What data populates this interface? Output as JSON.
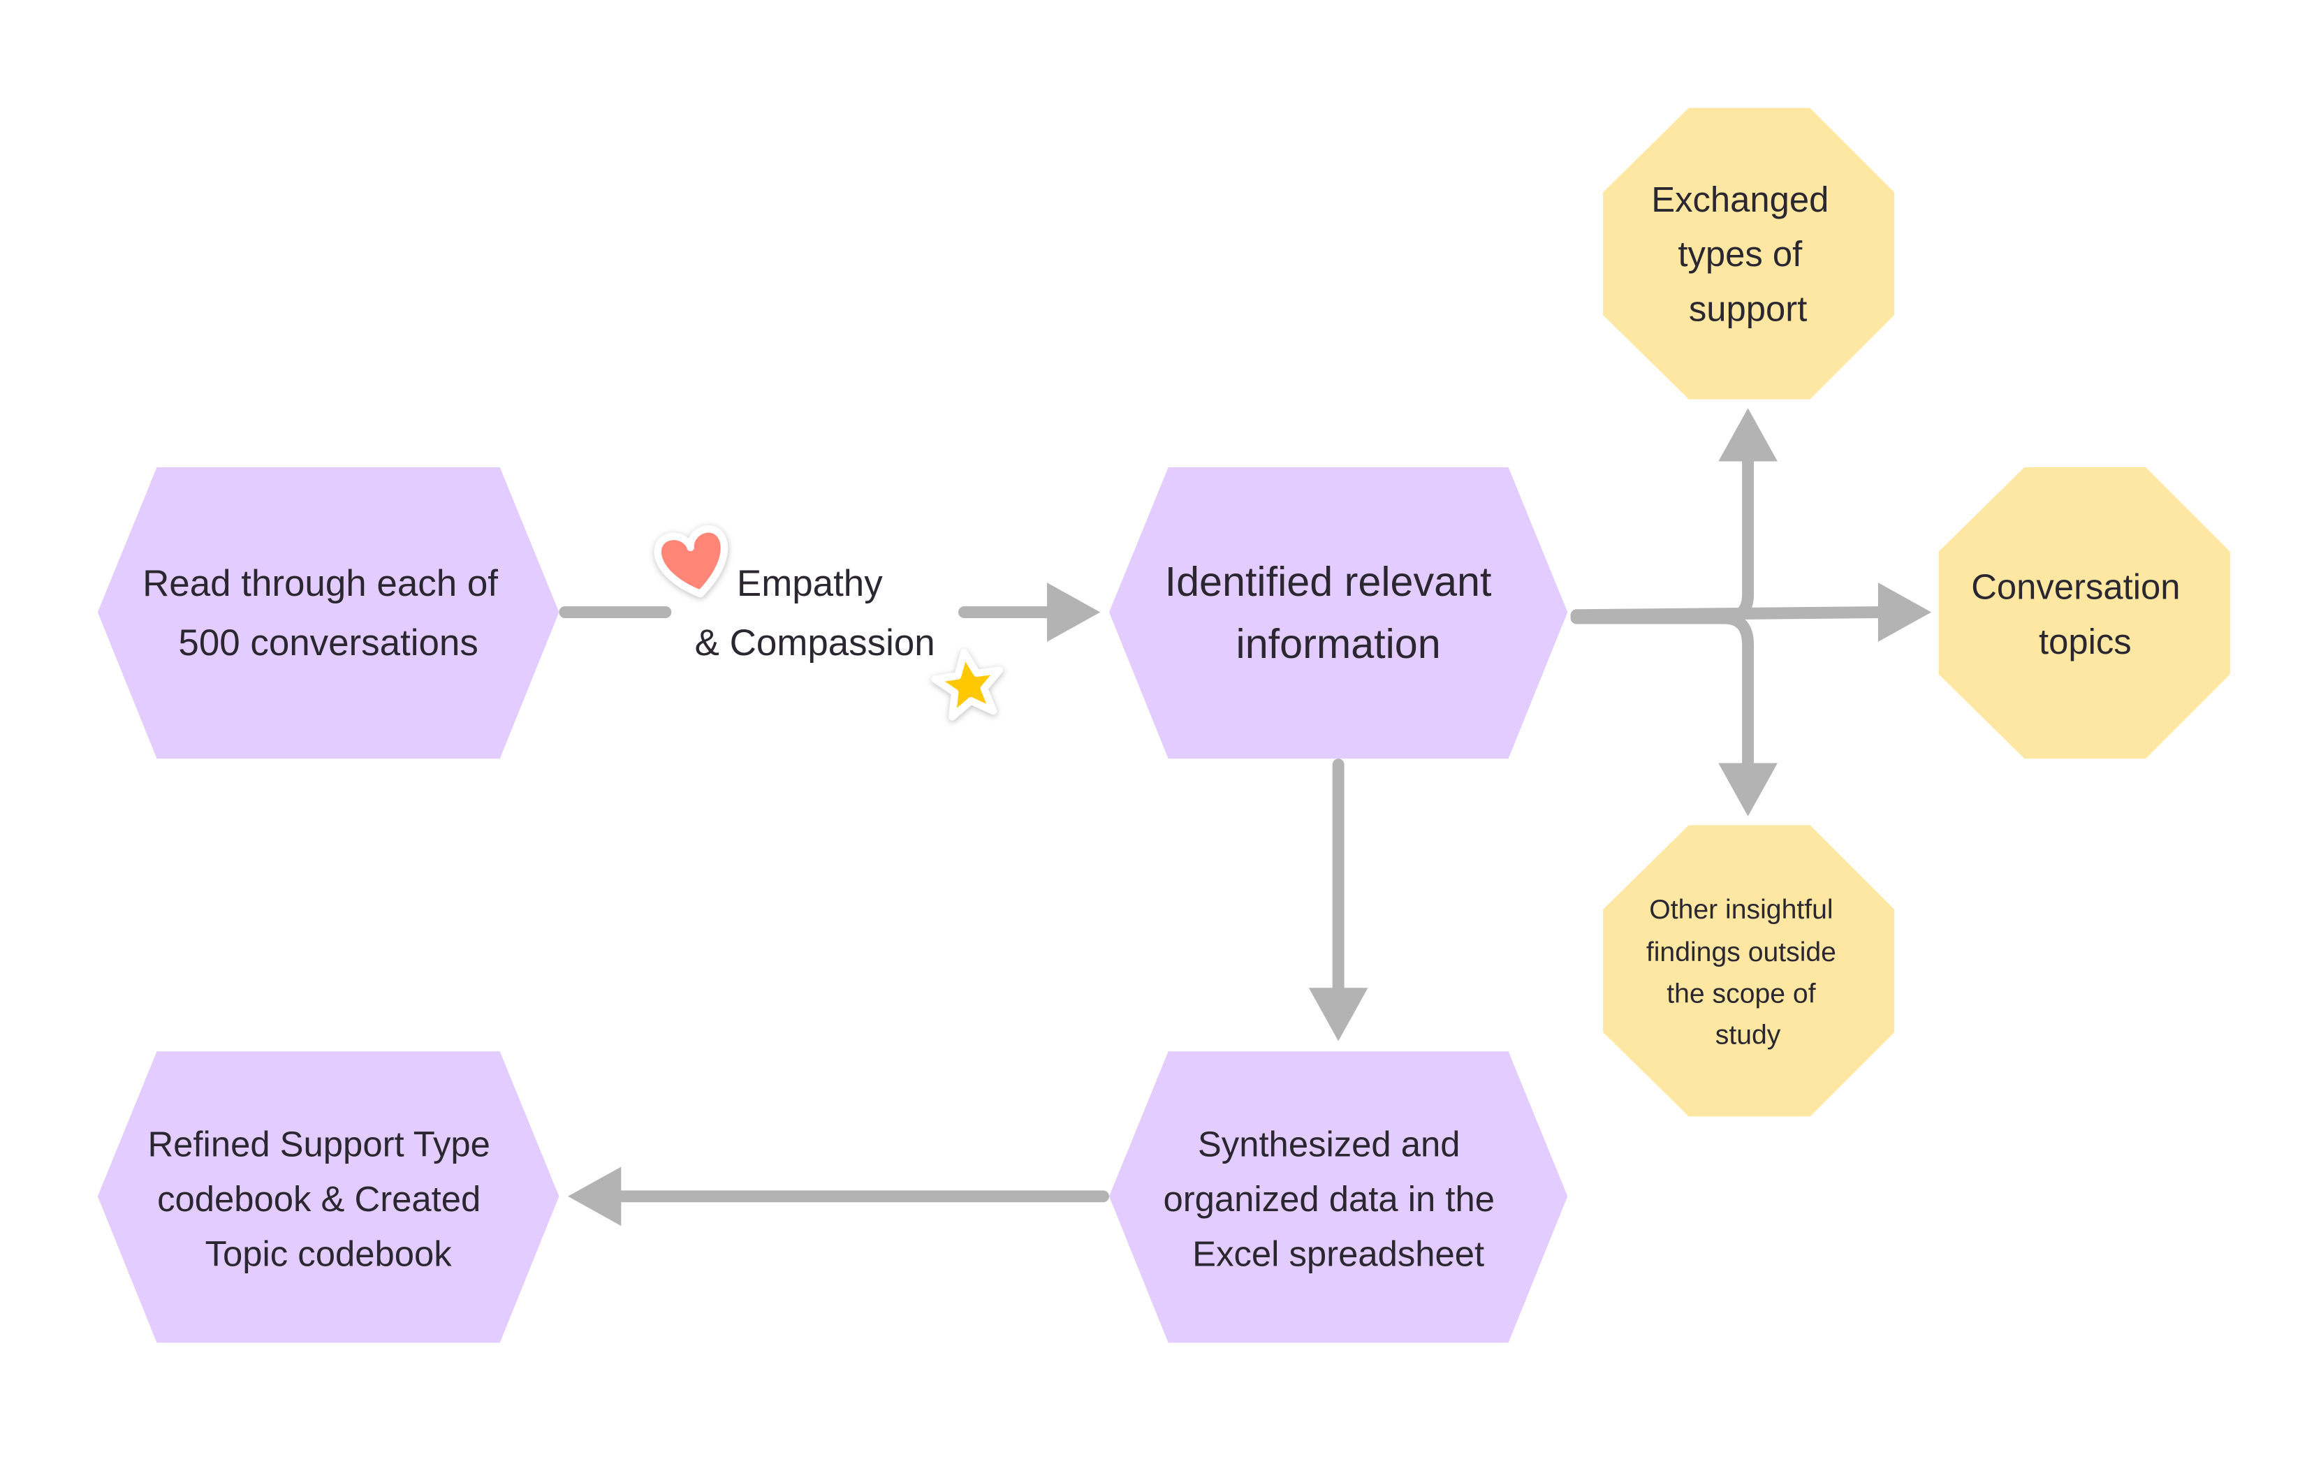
{
  "colors": {
    "process": "#e3ccff",
    "output": "#fde7a2",
    "connector": "#b3b3b3",
    "text": "#2b2730",
    "heart": "#ff8577",
    "star": "#ffc800"
  },
  "nodes": {
    "read": {
      "lines": [
        "Read through each of",
        "500 conversations"
      ]
    },
    "identified": {
      "lines": [
        "Identified relevant",
        "information"
      ]
    },
    "synthesized": {
      "lines": [
        "Synthesized and",
        "organized data in the",
        "Excel spreadsheet"
      ]
    },
    "refined": {
      "lines": [
        "Refined Support Type",
        "codebook & Created",
        "Topic codebook"
      ]
    },
    "exchanged": {
      "lines": [
        "Exchanged",
        "types of",
        "support"
      ]
    },
    "topics": {
      "lines": [
        "Conversation",
        "topics"
      ]
    },
    "other": {
      "lines": [
        "Other insightful",
        "findings outside",
        "the scope of",
        "study"
      ]
    }
  },
  "edge_label": {
    "lines": [
      "Empathy",
      "& Compassion"
    ]
  },
  "stickers": [
    "heart-icon",
    "star-icon"
  ]
}
